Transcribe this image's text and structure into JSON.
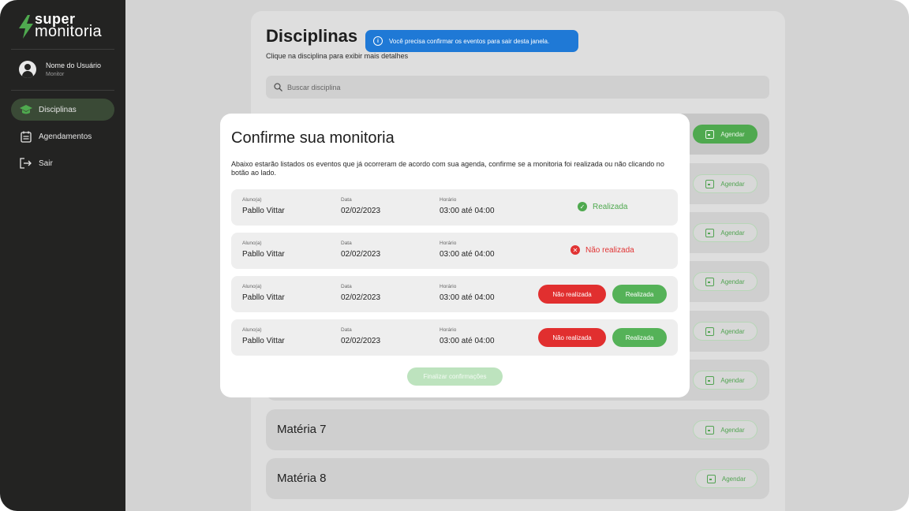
{
  "app": {
    "logo_line1": "super",
    "logo_line2": "monitoria",
    "brand_color": "#4fa94f"
  },
  "user": {
    "name": "Nome do Usuário",
    "role": "Monitor"
  },
  "sidebar": {
    "items": [
      {
        "label": "Disciplinas",
        "icon": "graduation-cap-icon",
        "active": true
      },
      {
        "label": "Agendamentos",
        "icon": "calendar-list-icon",
        "active": false
      },
      {
        "label": "Sair",
        "icon": "logout-icon",
        "active": false
      }
    ]
  },
  "page": {
    "title": "Disciplinas",
    "subtitle": "Clique na disciplina para exibir mais detalhes",
    "search_placeholder": "Buscar disciplina"
  },
  "toast": {
    "text": "Você precisa confirmar os eventos para sair desta janela.",
    "color": "#1f79d6"
  },
  "subjects": {
    "agendar_label": "Agendar",
    "rows": [
      {
        "name": ""
      },
      {
        "name": ""
      },
      {
        "name": ""
      },
      {
        "name": ""
      },
      {
        "name": ""
      },
      {
        "name": ""
      },
      {
        "name": "Matéria 7"
      },
      {
        "name": "Matéria 8"
      }
    ]
  },
  "modal": {
    "title": "Confirme sua monitoria",
    "description": "Abaixo estarão listados os eventos que já ocorreram de acordo com sua agenda, confirme se a monitoria foi realizada ou não clicando no botão ao lado.",
    "labels": {
      "student": "Aluno(a)",
      "date": "Data",
      "time": "Horário"
    },
    "events": [
      {
        "student": "Pabllo Vittar",
        "date": "02/02/2023",
        "time": "03:00 até 04:00",
        "status": "Realizada"
      },
      {
        "student": "Pabllo Vittar",
        "date": "02/02/2023",
        "time": "03:00 até 04:00",
        "status": "Não realizada"
      },
      {
        "student": "Pabllo Vittar",
        "date": "02/02/2023",
        "time": "03:00 até 04:00",
        "status": ""
      },
      {
        "student": "Pabllo Vittar",
        "date": "02/02/2023",
        "time": "03:00 até 04:00",
        "status": ""
      }
    ],
    "btn_not_done": "Não realizada",
    "btn_done": "Realizada",
    "finalize_label": "Finalizar confirmações"
  }
}
